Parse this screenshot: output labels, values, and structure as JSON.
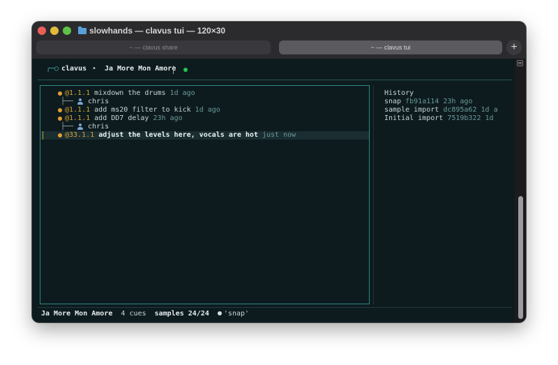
{
  "window": {
    "title": "slowhands — clavus tui — 120×30"
  },
  "tabs": [
    {
      "label": "~ — clavus share",
      "active": false
    },
    {
      "label": "~ — clavus tui",
      "active": true
    }
  ],
  "new_tab_label": "+",
  "header": {
    "app_icon": "╭─○",
    "app": "clavus",
    "separator": "•",
    "project": "Ja More Mon Amore",
    "status": "connected-dot"
  },
  "cues": [
    {
      "cue": "@1.1.1",
      "text": "mixdown the drums",
      "time": "1d ago",
      "bold": false
    },
    {
      "author": "chris"
    },
    {
      "cue": "@1.1.1",
      "text": "add ms20 filter to kick",
      "time": "1d ago",
      "bold": false
    },
    {
      "cue": "@1.1.1",
      "text": "add DD7 delay",
      "time": "23h ago",
      "bold": false
    },
    {
      "author": "chris"
    },
    {
      "cue": "@33.1.1",
      "text": "adjust the levels here, vocals are hot",
      "time": "just now",
      "bold": true,
      "selected": true
    }
  ],
  "history": {
    "title": "History",
    "items": [
      {
        "name": "snap",
        "hash": "fb91a114",
        "time": "23h ago"
      },
      {
        "name": "sample import",
        "hash": "dc895a62",
        "time": "1d a"
      },
      {
        "name": "Initial import",
        "hash": "7519b322",
        "time": "1d"
      }
    ]
  },
  "status": {
    "project": "Ja More Mon Amore",
    "cues": "4 cues",
    "samples": "samples 24/24",
    "snapshot": "'snap'"
  },
  "colors": {
    "accent": "#2e8a86",
    "cue": "#d7a234",
    "connected": "#23c552",
    "background": "#0d1b1f"
  }
}
